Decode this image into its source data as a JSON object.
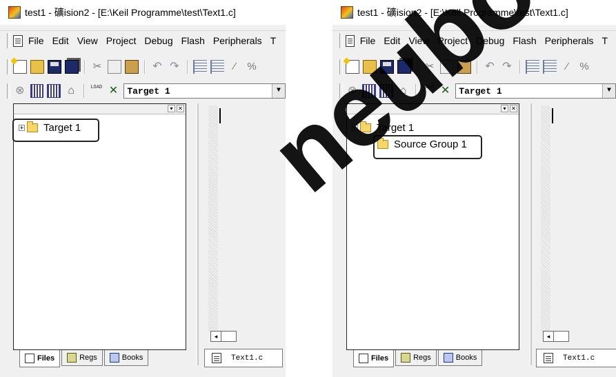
{
  "window": {
    "title": "test1  - 礦ision2 - [E:\\Keil Programme\\test\\Text1.c]"
  },
  "menu": {
    "items": [
      "File",
      "Edit",
      "View",
      "Project",
      "Debug",
      "Flash",
      "Peripherals",
      "T"
    ]
  },
  "toolbar": {
    "target_selected": "Target 1",
    "load_label": "LOAD"
  },
  "left_panel": {
    "tree": {
      "root": "Target 1",
      "root_expander": "+"
    }
  },
  "right_panel": {
    "tree": {
      "root": "Target 1",
      "root_expander": "−",
      "child": "Source Group 1"
    }
  },
  "workspace_tabs": {
    "files": "Files",
    "regs": "Regs",
    "books": "Books"
  },
  "editor": {
    "tab_label": "Text1.c"
  },
  "watermark": {
    "text": "neubooks.c"
  },
  "icons": {
    "app": "uvision-app-icon",
    "folder_color": "#f6d56a",
    "highlight_border": "#222222"
  }
}
